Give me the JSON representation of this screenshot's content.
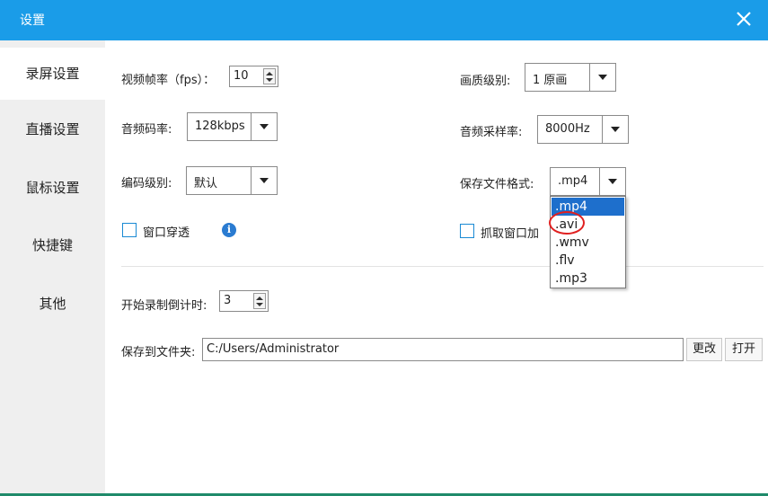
{
  "window": {
    "title": "设置"
  },
  "sidebar": {
    "items": [
      {
        "label": "录屏设置"
      },
      {
        "label": "直播设置"
      },
      {
        "label": "鼠标设置"
      },
      {
        "label": "快捷键"
      },
      {
        "label": "其他"
      }
    ],
    "active_index": 0
  },
  "form": {
    "fps_label": "视频帧率（fps）：",
    "fps_value": "10",
    "quality_label": "画质级别:",
    "quality_value": "1 原画",
    "audio_bitrate_label": "音频码率:",
    "audio_bitrate_value": "128kbps",
    "sample_rate_label": "音频采样率:",
    "sample_rate_value": "8000Hz",
    "encode_level_label": "编码级别:",
    "encode_level_value": "默认",
    "file_format_label": "保存文件格式:",
    "file_format_value": ".mp4",
    "window_penetrate_label": "窗口穿透",
    "window_penetrate_checked": false,
    "capture_window_label": "抓取窗口加",
    "capture_window_checked": false,
    "countdown_label": "开始录制倒计时:",
    "countdown_value": "3",
    "save_folder_label": "保存到文件夹:",
    "save_folder_value": "C:/Users/Administrator",
    "change_button": "更改",
    "open_button": "打开"
  },
  "format_dropdown": {
    "options": [
      ".mp4",
      ".avi",
      ".wmv",
      ".flv",
      ".mp3"
    ],
    "highlighted_index": 0,
    "circled_index": 1
  },
  "colors": {
    "titlebar": "#1a9ce8",
    "highlight": "#1e6fcc",
    "annotation": "#e02020"
  }
}
